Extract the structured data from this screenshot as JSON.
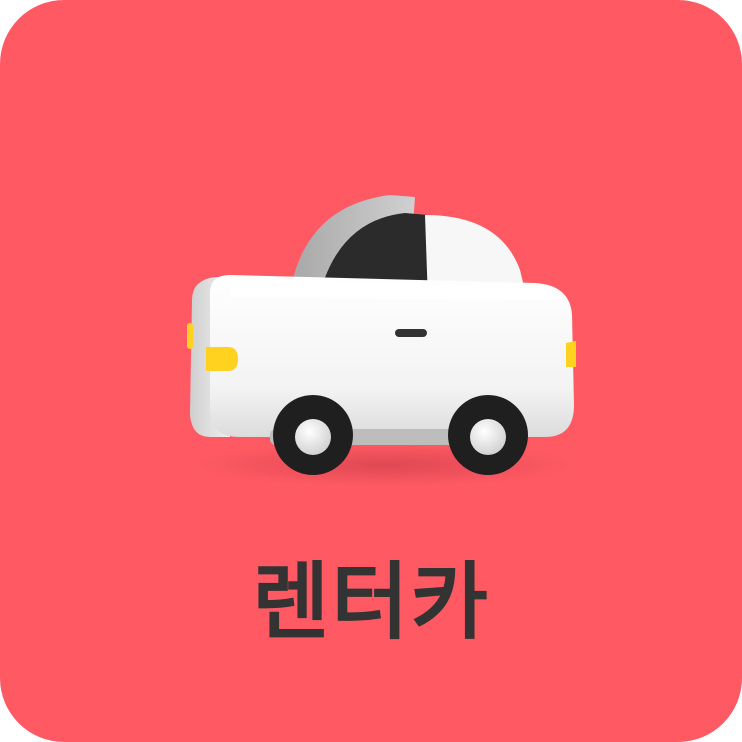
{
  "tile": {
    "label": "렌터카",
    "background_color": "#FF5A64",
    "text_color": "#333333"
  },
  "icon": {
    "name": "rental-car-icon"
  }
}
